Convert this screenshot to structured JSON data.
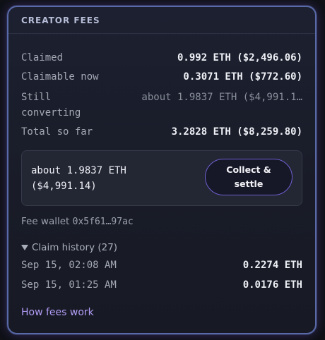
{
  "card": {
    "title": "CREATOR FEES"
  },
  "stats": {
    "claimed_label": "Claimed",
    "claimed_value": "0.992 ETH ($2,496.06)",
    "claimable_label": "Claimable now",
    "claimable_value": "0.3071 ETH ($772.60)",
    "converting_label": "Still converting",
    "converting_value": "about 1.9837 ETH ($4,991.1…",
    "total_label": "Total so far",
    "total_value": "3.2828 ETH ($8,259.80)"
  },
  "settle": {
    "amount_line1": "about 1.9837 ETH",
    "amount_line2": "($4,991.14)",
    "button_label": "Collect & settle"
  },
  "fee_wallet": {
    "label": "Fee wallet",
    "address": "0x5f61…97ac"
  },
  "claim_history": {
    "toggle_label": "Claim history (27)",
    "items": [
      {
        "date": "Sep 15, 02:08 AM",
        "amount": "0.2274 ETH"
      },
      {
        "date": "Sep 15, 01:25 AM",
        "amount": "0.0176 ETH"
      }
    ]
  },
  "links": {
    "how_fees_work": "How fees work"
  },
  "colors": {
    "accent": "#6f5fd0",
    "link": "#b29cf6",
    "card_border": "#5a6aa8"
  }
}
